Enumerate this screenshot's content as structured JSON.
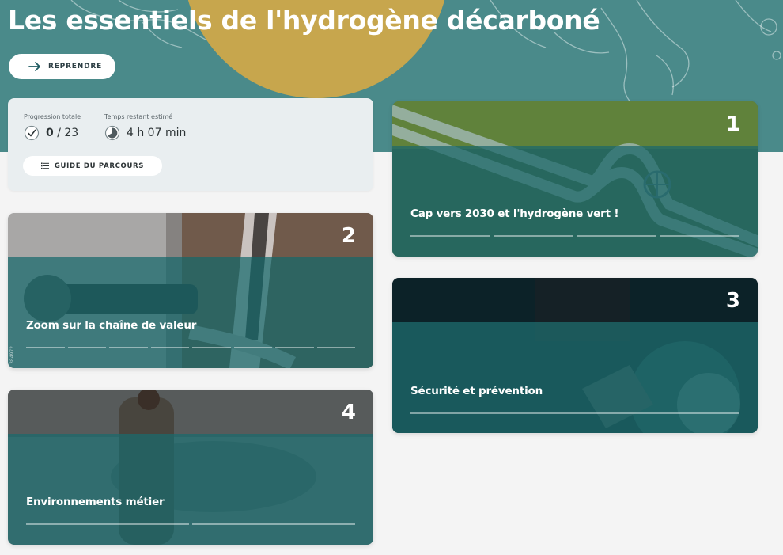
{
  "page": {
    "title": "Les essentiels de l'hydrogène décarboné",
    "resume_label": "REPRENDRE"
  },
  "progress": {
    "total_caption": "Progression totale",
    "done": "0",
    "total": "/ 23",
    "time_caption": "Temps restant estimé",
    "time_value": "4 h 07 min",
    "guide_label": "GUIDE DU PARCOURS"
  },
  "modules": [
    {
      "number": "1",
      "title": "Cap vers 2030 et l'hydrogène vert !",
      "segments": 4
    },
    {
      "number": "2",
      "title": "Zoom sur la chaîne de valeur",
      "segments": 8,
      "photo_code": "384972"
    },
    {
      "number": "3",
      "title": "Sécurité et prévention",
      "segments": 1
    },
    {
      "number": "4",
      "title": "Environnements métier",
      "segments": 2
    }
  ],
  "icons": {
    "resume": "arrow-right-icon",
    "progress": "check-circle-icon",
    "time": "clock-icon",
    "guide": "list-icon"
  },
  "colors": {
    "hero_teal": "#4a8a8a",
    "sun_gold": "#c7a64d",
    "card_teal": "#1c6768",
    "panel_bg": "#e9eef0"
  }
}
